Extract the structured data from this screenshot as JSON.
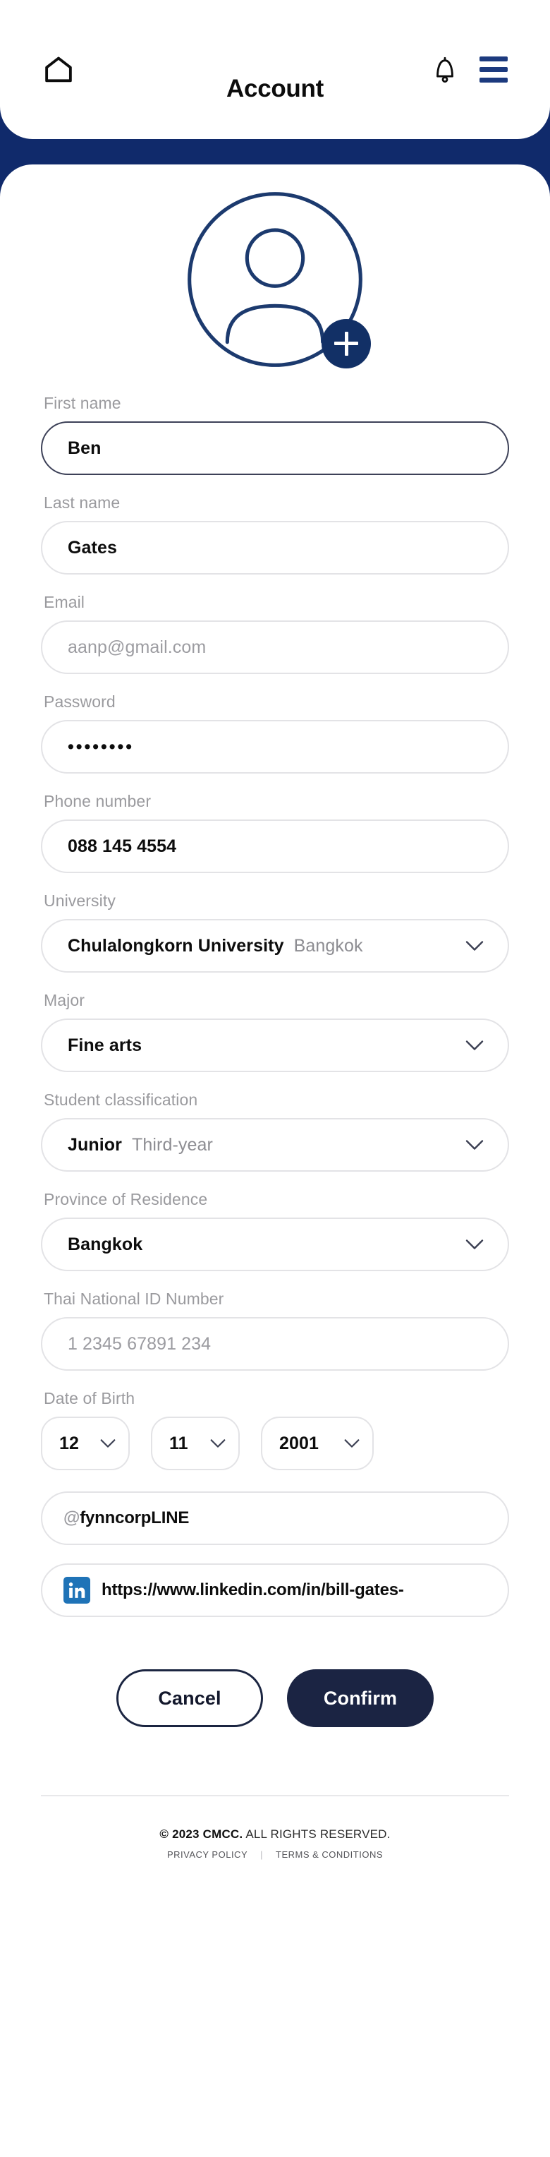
{
  "header": {
    "title": "Account",
    "home_icon": "home-icon",
    "bell_icon": "bell-icon",
    "menu_icon": "hamburger-menu-icon"
  },
  "avatar": {
    "icon": "user-avatar-icon",
    "badge_icon": "plus-icon"
  },
  "theme": {
    "navy": "#102a6b",
    "button_navy": "#1b2443",
    "border_gray": "#e3e3e6",
    "label_gray": "#9a9a9e",
    "linkedin_blue": "#1f73b7"
  },
  "form": {
    "first_name": {
      "label": "First name",
      "value": "Ben"
    },
    "last_name": {
      "label": "Last name",
      "value": "Gates"
    },
    "email": {
      "label": "Email",
      "placeholder": "aanp@gmail.com"
    },
    "password": {
      "label": "Password",
      "value": "••••••••"
    },
    "phone": {
      "label": "Phone number",
      "value": "088 145 4554"
    },
    "university": {
      "label": "University",
      "value": "Chulalongkorn University",
      "suffix": "Bangkok"
    },
    "major": {
      "label": "Major",
      "value": "Fine arts"
    },
    "classification": {
      "label": "Student classification",
      "value": "Junior",
      "suffix": "Third-year"
    },
    "province": {
      "label": "Province of Residence",
      "value": "Bangkok"
    },
    "national_id": {
      "label": "Thai National ID Number",
      "placeholder": "1  2345  67891  234"
    },
    "dob": {
      "label": "Date of Birth",
      "day": "12",
      "month": "11",
      "year": "2001"
    },
    "line": {
      "at": "@",
      "value": "fynncorpLINE"
    },
    "linkedin": {
      "icon": "linkedin-icon",
      "value": "https://www.linkedin.com/in/bill-gates-"
    }
  },
  "actions": {
    "cancel": "Cancel",
    "confirm": "Confirm"
  },
  "footer": {
    "copyright": "© 2023 CMCC.",
    "rights": "ALL RIGHTS RESERVED.",
    "privacy": "PRIVACY POLICY",
    "separator": "|",
    "terms": "TERMS & CONDITIONS"
  }
}
